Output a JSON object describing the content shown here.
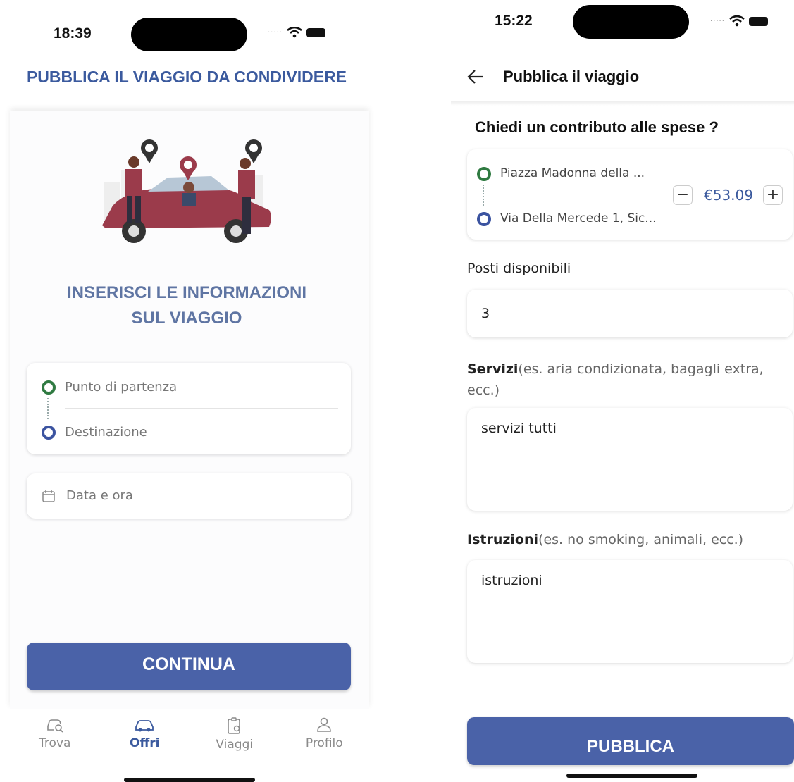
{
  "left_screen": {
    "status_time": "18:39",
    "page_title": "PUBBLICA IL VIAGGIO DA CONDIVIDERE",
    "heading_line1": "INSERISCI LE INFORMAZIONI",
    "heading_line2": "SUL VIAGGIO",
    "route": {
      "origin_placeholder": "Punto di partenza",
      "destination_placeholder": "Destinazione"
    },
    "datetime_placeholder": "Data e ora",
    "continue_label": "CONTINUA",
    "nav": [
      {
        "label": "Trova",
        "icon": "car-search-icon",
        "active": false
      },
      {
        "label": "Offri",
        "icon": "car-icon",
        "active": true
      },
      {
        "label": "Viaggi",
        "icon": "trips-icon",
        "active": false
      },
      {
        "label": "Profilo",
        "icon": "user-icon",
        "active": false
      }
    ]
  },
  "right_screen": {
    "status_time": "15:22",
    "header_title": "Pubblica il viaggio",
    "question": "Chiedi un contributo alle spese ?",
    "route": {
      "origin": "Piazza Madonna della ...",
      "destination": "Via Della Mercede 1, Sic..."
    },
    "price": "€53.09",
    "seats_label": "Posti disponibili",
    "seats_value": "3",
    "services_label": "Servizi",
    "services_hint": "(es. aria condizionata, bagagli extra, ecc.)",
    "services_value": "servizi tutti",
    "instructions_label": "Istruzioni",
    "instructions_hint": "(es. no smoking, animali, ecc.)",
    "instructions_value": "istruzioni",
    "publish_label": "PUBBLICA"
  },
  "colors": {
    "primary": "#4a62a8",
    "title_blue": "#3b5a9e",
    "origin_green": "#2f7a41",
    "dest_blue": "#3b53a0"
  }
}
